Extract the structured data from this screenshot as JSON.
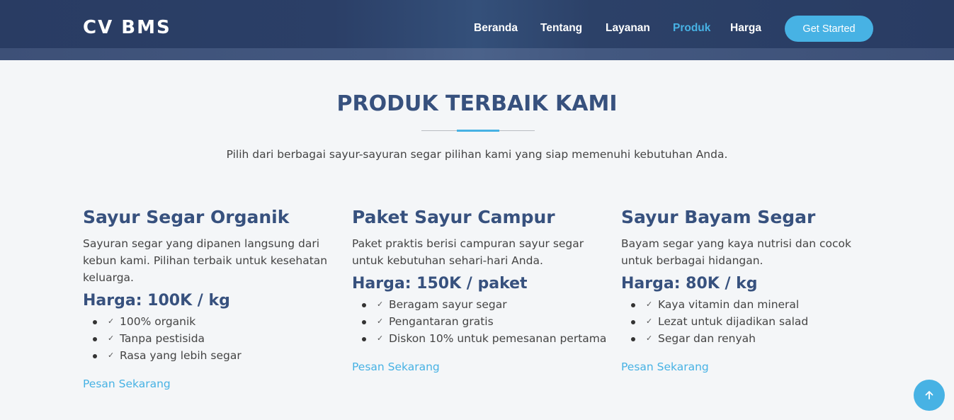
{
  "header": {
    "logo": "CV BMS",
    "nav": [
      "Beranda",
      "Tentang",
      "Layanan",
      "Produk",
      "Harga"
    ],
    "active_nav": "Produk",
    "cta": "Get Started"
  },
  "section": {
    "title": "PRODUK TERBAIK KAMI",
    "subtitle": "Pilih dari berbagai sayur-sayuran segar pilihan kami yang siap memenuhi kebutuhan Anda."
  },
  "products": [
    {
      "title": "Sayur Segar Organik",
      "description": "Sayuran segar yang dipanen langsung dari kebun kami. Pilihan terbaik untuk kesehatan keluarga.",
      "price": "Harga: 100K / kg",
      "features": [
        "100% organik",
        "Tanpa pestisida",
        "Rasa yang lebih segar"
      ],
      "link": "Pesan Sekarang"
    },
    {
      "title": "Paket Sayur Campur",
      "description": "Paket praktis berisi campuran sayur segar untuk kebutuhan sehari-hari Anda.",
      "price": "Harga: 150K / paket",
      "features": [
        "Beragam sayur segar",
        "Pengantaran gratis",
        "Diskon 10% untuk pemesanan pertama"
      ],
      "link": "Pesan Sekarang"
    },
    {
      "title": "Sayur Bayam Segar",
      "description": "Bayam segar yang kaya nutrisi dan cocok untuk berbagai hidangan.",
      "price": "Harga: 80K / kg",
      "features": [
        "Kaya vitamin dan mineral",
        "Lezat untuk dijadikan salad",
        "Segar dan renyah"
      ],
      "link": "Pesan Sekarang"
    }
  ],
  "icons": {
    "check": "check-icon",
    "scroll_top": "arrow-up-icon"
  },
  "colors": {
    "header": "#293c63",
    "accent": "#47b2e4",
    "heading": "#37517e",
    "background": "#f4f6f8"
  }
}
